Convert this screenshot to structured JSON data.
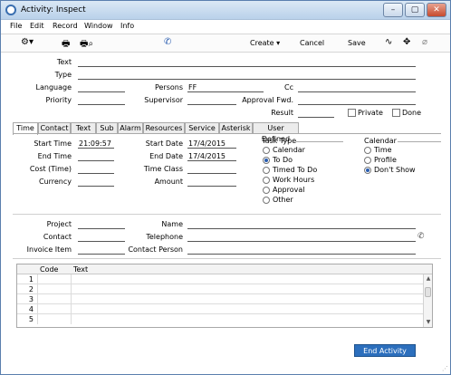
{
  "window": {
    "title": "Activity: Inspect",
    "minimize": "–",
    "maximize": "▢",
    "close": "✕"
  },
  "menu": [
    "File",
    "Edit",
    "Record",
    "Window",
    "Info"
  ],
  "toolbar": {
    "gear": "⚙▾",
    "print": "🖶",
    "print_preview": "🖶⌕",
    "phone": "✆",
    "create": "Create ▾",
    "cancel": "Cancel",
    "save": "Save",
    "chart": "∿",
    "expand": "✥",
    "attach": "⌀"
  },
  "header": {
    "text_label": "Text",
    "text_value": "",
    "type_label": "Type",
    "type_value": "",
    "language_label": "Language",
    "language_value": "",
    "persons_label": "Persons",
    "persons_value": "FF",
    "cc_label": "Cc",
    "cc_value": "",
    "priority_label": "Priority",
    "priority_value": "",
    "supervisor_label": "Supervisor",
    "supervisor_value": "",
    "approval_fwd_label": "Approval Fwd.",
    "approval_fwd_value": "",
    "result_label": "Result",
    "result_value": "",
    "private_label": "Private",
    "private_checked": false,
    "done_label": "Done",
    "done_checked": false
  },
  "tabs": [
    "Time",
    "Contact",
    "Text",
    "Sub",
    "Alarm",
    "Resources",
    "Service",
    "Asterisk",
    "User Defined"
  ],
  "active_tab": "Time",
  "time_tab": {
    "start_time_label": "Start Time",
    "start_time": "21:09:57",
    "end_time_label": "End Time",
    "end_time": "",
    "cost_time_label": "Cost (Time)",
    "cost_time": "",
    "currency_label": "Currency",
    "currency": "",
    "start_date_label": "Start Date",
    "start_date": "17/4/2015",
    "end_date_label": "End Date",
    "end_date": "17/4/2015",
    "time_class_label": "Time Class",
    "time_class": "",
    "amount_label": "Amount",
    "amount": "",
    "task_type_label": "Task Type",
    "task_types": [
      "Calendar",
      "To Do",
      "Timed To Do",
      "Work Hours",
      "Approval",
      "Other"
    ],
    "task_type_selected": "To Do",
    "calendar_label": "Calendar",
    "calendar_options": [
      "Time",
      "Profile",
      "Don't Show"
    ],
    "calendar_selected": "Don't Show"
  },
  "links": {
    "project_label": "Project",
    "project": "",
    "contact_label": "Contact",
    "contact": "",
    "invoice_item_label": "Invoice Item",
    "invoice_item": "",
    "name_label": "Name",
    "name": "",
    "telephone_label": "Telephone",
    "telephone": "",
    "contact_person_label": "Contact Person",
    "contact_person": ""
  },
  "grid": {
    "columns": [
      "",
      "Code",
      "Text"
    ],
    "rows": [
      {
        "num": "1",
        "code": "",
        "text": ""
      },
      {
        "num": "2",
        "code": "",
        "text": ""
      },
      {
        "num": "3",
        "code": "",
        "text": ""
      },
      {
        "num": "4",
        "code": "",
        "text": ""
      },
      {
        "num": "5",
        "code": "",
        "text": ""
      }
    ]
  },
  "actions": {
    "end_activity": "End Activity"
  },
  "colors": {
    "accent": "#2c6fbd",
    "radio_dot": "#2a5db0"
  }
}
